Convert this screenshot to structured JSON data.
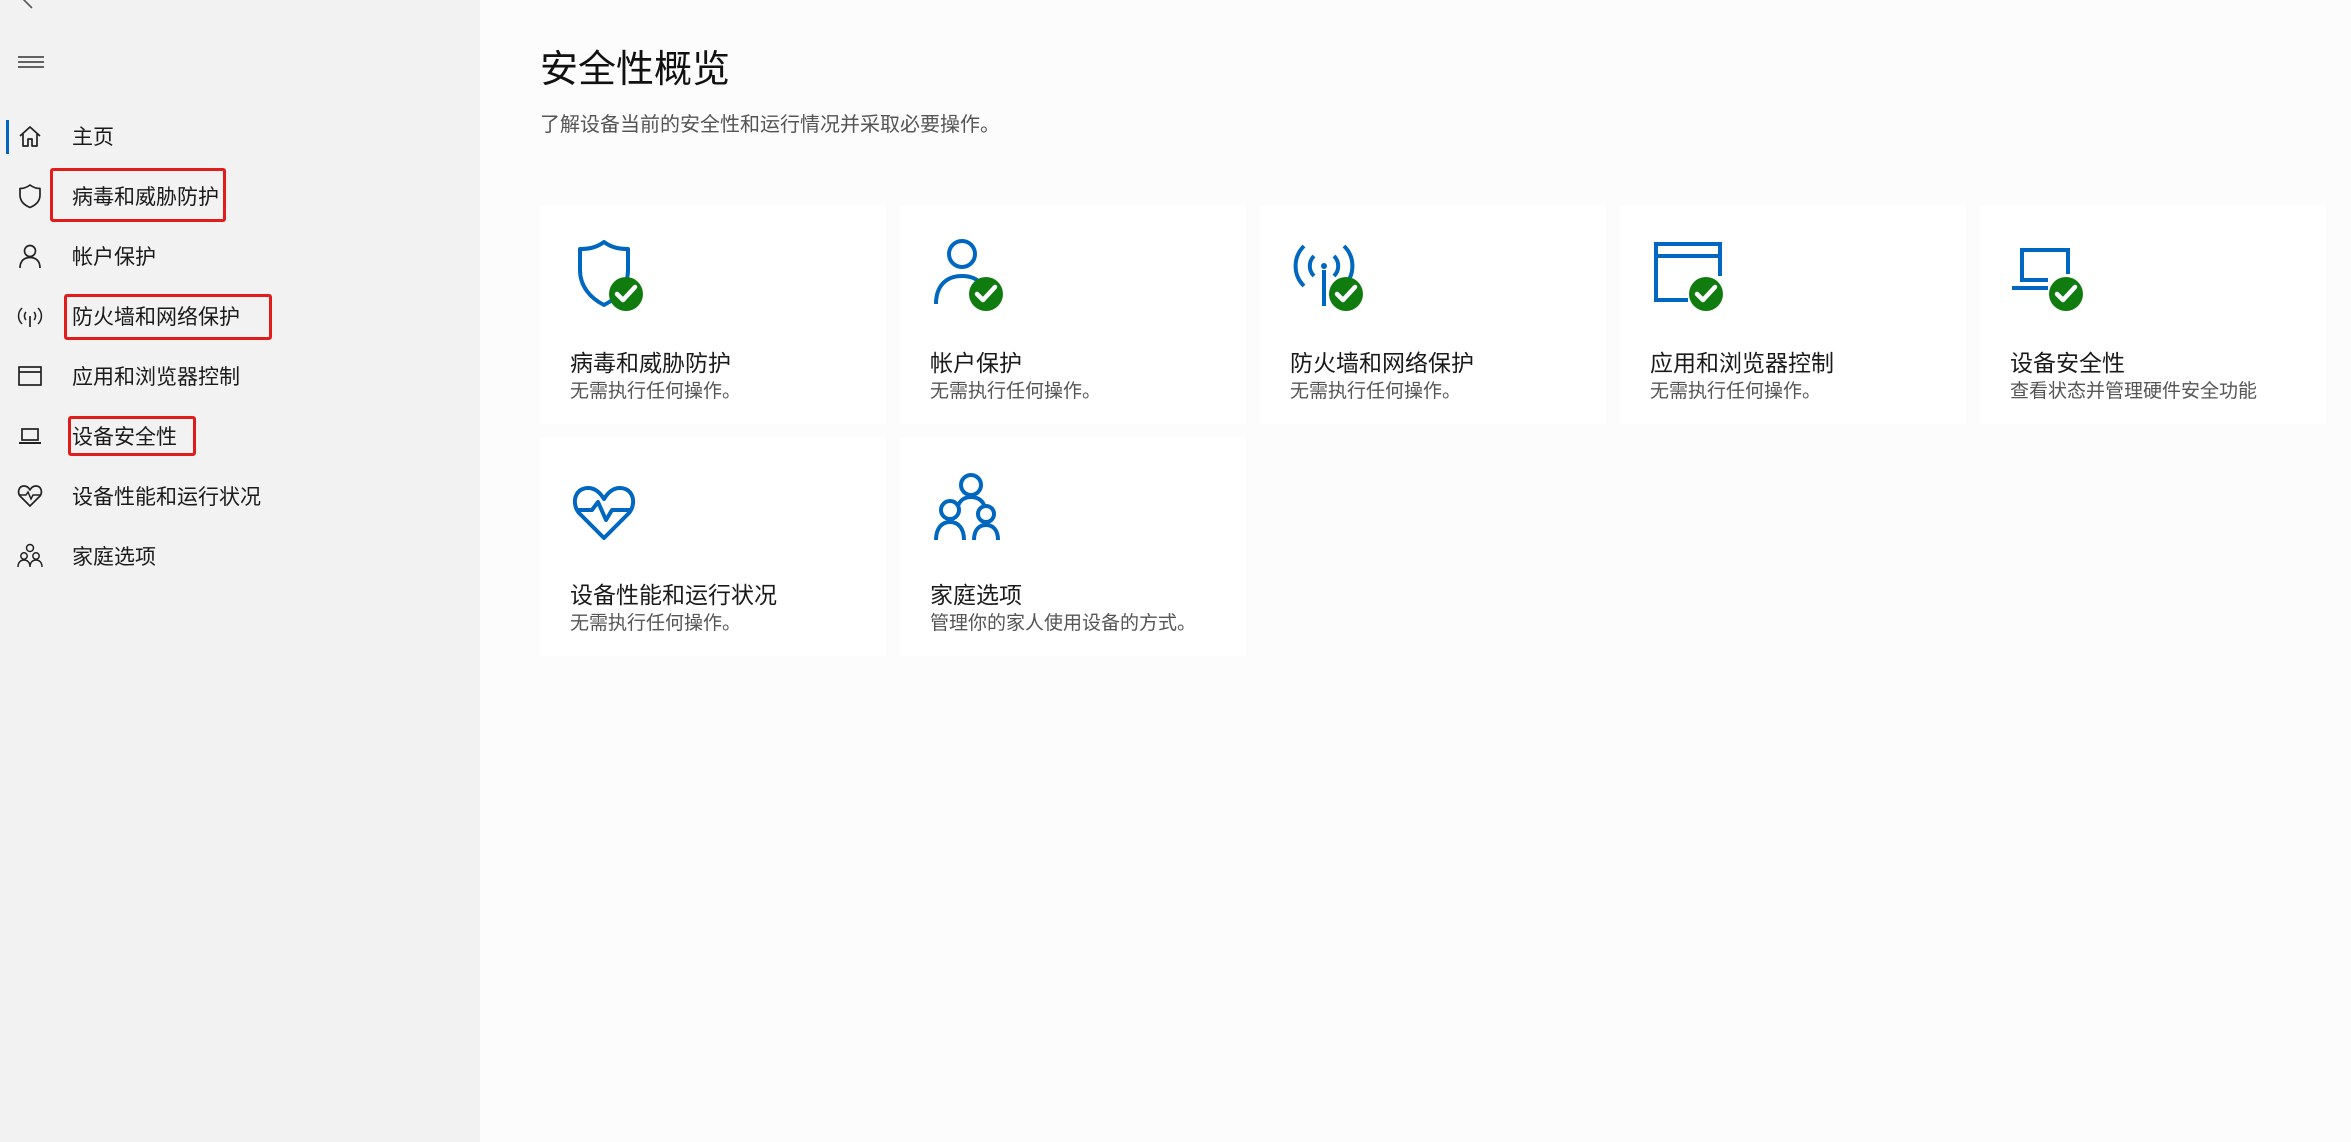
{
  "sidebar": {
    "items": [
      {
        "label": "主页",
        "icon": "home-icon"
      },
      {
        "label": "病毒和威胁防护",
        "icon": "shield-icon"
      },
      {
        "label": "帐户保护",
        "icon": "person-icon"
      },
      {
        "label": "防火墙和网络保护",
        "icon": "wireless-antenna-icon"
      },
      {
        "label": "应用和浏览器控制",
        "icon": "app-window-icon"
      },
      {
        "label": "设备安全性",
        "icon": "laptop-icon"
      },
      {
        "label": "设备性能和运行状况",
        "icon": "heart-pulse-icon"
      },
      {
        "label": "家庭选项",
        "icon": "family-icon"
      }
    ]
  },
  "main": {
    "title": "安全性概览",
    "description": "了解设备当前的安全性和运行情况并采取必要操作。",
    "tiles": [
      {
        "title": "病毒和威胁防护",
        "subtitle": "无需执行任何操作。",
        "icon": "shield-icon",
        "status": "ok"
      },
      {
        "title": "帐户保护",
        "subtitle": "无需执行任何操作。",
        "icon": "person-icon",
        "status": "ok"
      },
      {
        "title": "防火墙和网络保护",
        "subtitle": "无需执行任何操作。",
        "icon": "wireless-antenna-icon",
        "status": "ok"
      },
      {
        "title": "应用和浏览器控制",
        "subtitle": "无需执行任何操作。",
        "icon": "app-window-icon",
        "status": "ok"
      },
      {
        "title": "设备安全性",
        "subtitle": "查看状态并管理硬件安全功能",
        "icon": "laptop-icon",
        "status": "ok"
      },
      {
        "title": "设备性能和运行状况",
        "subtitle": "无需执行任何操作。",
        "icon": "heart-pulse-icon"
      },
      {
        "title": "家庭选项",
        "subtitle": "管理你的家人使用设备的方式。",
        "icon": "family-icon"
      }
    ]
  },
  "colors": {
    "accent": "#0067c0",
    "ok_green": "#107c10",
    "highlight_red": "#e21b1b",
    "sidebar_bg": "#f2f2f2"
  }
}
